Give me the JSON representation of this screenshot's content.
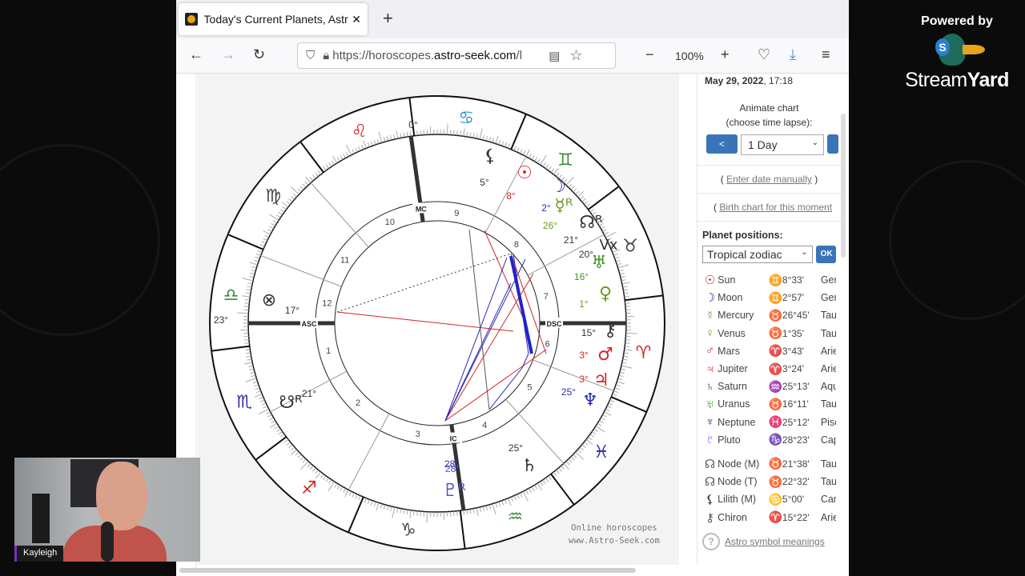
{
  "browser": {
    "tab_title": "Today's Current Planets, Astro-Seek",
    "url_prefix": "https://horoscopes.",
    "url_domain": "astro-seek.com",
    "url_suffix": "/l",
    "zoom": "100%"
  },
  "sidebar": {
    "date_bold": "May 29, 2022",
    "date_time": ", 17:18",
    "animate_line1": "Animate chart",
    "animate_line2": "(choose time lapse):",
    "prev_label": "<",
    "lapse_value": "1 Day",
    "enter_date": "Enter date manually",
    "birth_chart": "Birth chart for this moment",
    "positions_title": "Planet positions:",
    "zodiac_value": "Tropical zodiac",
    "ok_label": "OK",
    "planets": [
      {
        "glyph": "☉",
        "name": "Sun",
        "sign": "♊",
        "deg": "8°33'",
        "sign_name": "Gemini",
        "color": "#d2232a",
        "scolor": "#3a8a3a"
      },
      {
        "glyph": "☽",
        "name": "Moon",
        "sign": "♊",
        "deg": "2°57'",
        "sign_name": "Gemini",
        "color": "#2b2bb0",
        "scolor": "#3a8a3a"
      },
      {
        "glyph": "☿",
        "name": "Mercury",
        "sign": "♉",
        "deg": "26°45'",
        "sign_name": "Taurus",
        "color": "#6a9a1f",
        "scolor": "#555"
      },
      {
        "glyph": "♀",
        "name": "Venus",
        "sign": "♉",
        "deg": "1°35'",
        "sign_name": "Taurus",
        "color": "#6a9a1f",
        "scolor": "#555"
      },
      {
        "glyph": "♂",
        "name": "Mars",
        "sign": "♈",
        "deg": "3°43'",
        "sign_name": "Aries",
        "color": "#d2232a",
        "scolor": "#d2232a"
      },
      {
        "glyph": "♃",
        "name": "Jupiter",
        "sign": "♈",
        "deg": "3°24'",
        "sign_name": "Aries",
        "color": "#d2232a",
        "scolor": "#d2232a"
      },
      {
        "glyph": "♄",
        "name": "Saturn",
        "sign": "♒",
        "deg": "25°13'",
        "sign_name": "Aquarius",
        "color": "#444",
        "scolor": "#3a8a3a"
      },
      {
        "glyph": "♅",
        "name": "Uranus",
        "sign": "♉",
        "deg": "16°11'",
        "sign_name": "Taurus",
        "color": "#3a9a2a",
        "scolor": "#555"
      },
      {
        "glyph": "♆",
        "name": "Neptune",
        "sign": "♓",
        "deg": "25°12'",
        "sign_name": "Pisces",
        "color": "#2b2bb0",
        "scolor": "#2b6fd0"
      },
      {
        "glyph": "♇",
        "name": "Pluto",
        "sign": "♑",
        "deg": "28°23'",
        "sign_name": "Capricorn",
        "color": "#5050d0",
        "scolor": "#555"
      }
    ],
    "points": [
      {
        "glyph": "☊",
        "name": "Node (M)",
        "sign": "♉",
        "deg": "21°38'",
        "sign_name": "Taurus",
        "color": "#555",
        "scolor": "#555"
      },
      {
        "glyph": "☊",
        "name": "Node (T)",
        "sign": "♉",
        "deg": "22°32'",
        "sign_name": "Taurus",
        "color": "#555",
        "scolor": "#555"
      },
      {
        "glyph": "⚸",
        "name": "Lilith (M)",
        "sign": "♋",
        "deg": "5°00'",
        "sign_name": "Cancer",
        "color": "#333",
        "scolor": "#2b8fd0"
      },
      {
        "glyph": "⚷",
        "name": "Chiron",
        "sign": "♈",
        "deg": "15°22'",
        "sign_name": "Aries",
        "color": "#555",
        "scolor": "#d2232a"
      }
    ],
    "symbol_meanings": "Astro symbol meanings"
  },
  "chart": {
    "signs": [
      {
        "g": "♈",
        "c": "#d2232a"
      },
      {
        "g": "♉",
        "c": "#444"
      },
      {
        "g": "♊",
        "c": "#3a8a3a"
      },
      {
        "g": "♋",
        "c": "#2b8fd0"
      },
      {
        "g": "♌",
        "c": "#d2232a"
      },
      {
        "g": "♍",
        "c": "#444"
      },
      {
        "g": "♎",
        "c": "#3a8a3a"
      },
      {
        "g": "♏",
        "c": "#2b2bb0"
      },
      {
        "g": "♐",
        "c": "#d2232a"
      },
      {
        "g": "♑",
        "c": "#444"
      },
      {
        "g": "♒",
        "c": "#3a8a3a"
      },
      {
        "g": "♓",
        "c": "#2b2bb0"
      }
    ],
    "angles": {
      "asc": "ASC",
      "dsc": "DSC",
      "mc": "MC",
      "ic": "IC",
      "asc_deg": "23°",
      "mc_deg": "0°",
      "ic_deg": "28°"
    },
    "house_numbers": [
      "1",
      "2",
      "3",
      "4",
      "5",
      "6",
      "7",
      "8",
      "9",
      "10",
      "11",
      "12"
    ],
    "planet_labels": [
      {
        "g": "⚸",
        "d": "5°",
        "c": "#333"
      },
      {
        "g": "☉",
        "d": "8°",
        "c": "#d2232a"
      },
      {
        "g": "☽",
        "d": "2°",
        "c": "#2b2bb0"
      },
      {
        "g": "☿ᴿ",
        "d": "26°",
        "c": "#6a9a1f"
      },
      {
        "g": "☊ᴿ",
        "d": "21°",
        "c": "#333"
      },
      {
        "g": "Vx",
        "d": "20°",
        "c": "#333"
      },
      {
        "g": "♅",
        "d": "16°",
        "c": "#3a9a2a"
      },
      {
        "g": "♀",
        "d": "1°",
        "c": "#6a9a1f"
      },
      {
        "g": "⚷",
        "d": "15°",
        "c": "#333"
      },
      {
        "g": "♂",
        "d": "3°",
        "c": "#d2232a"
      },
      {
        "g": "♃",
        "d": "3°",
        "c": "#d2232a"
      },
      {
        "g": "♆",
        "d": "25°",
        "c": "#2b2bb0"
      },
      {
        "g": "♄",
        "d": "25°",
        "c": "#333"
      },
      {
        "g": "♇ᴿ",
        "d": "28°",
        "c": "#5050d0"
      },
      {
        "g": "☋ᴿ",
        "d": "21°",
        "c": "#333"
      },
      {
        "g": "⊗",
        "d": "17°",
        "c": "#333"
      }
    ],
    "watermark1": "Online horoscopes",
    "watermark2": "www.Astro-Seek.com"
  },
  "overlay": {
    "powered_by": "Powered by",
    "brand_a": "Stream",
    "brand_b": "Yard",
    "cam_name": "Kayleigh"
  }
}
